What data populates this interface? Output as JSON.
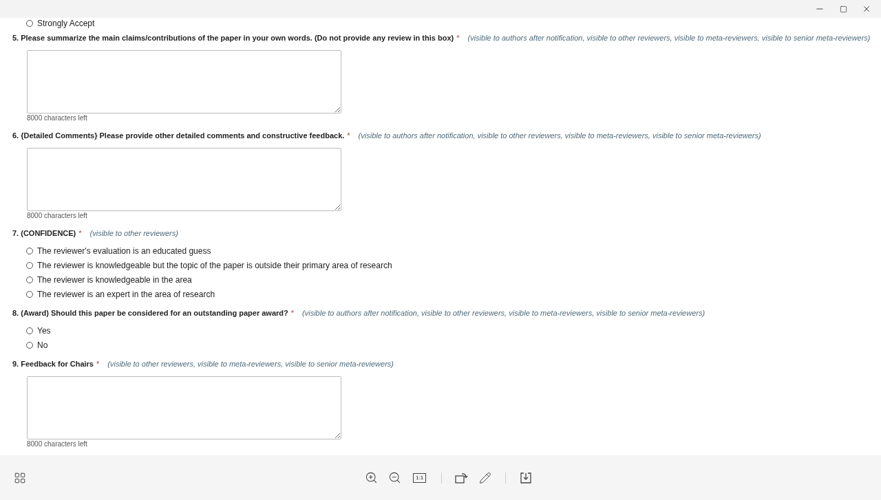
{
  "form": {
    "leading_options": [
      {
        "label": "Strongly Accept",
        "selected": false
      }
    ],
    "questions": [
      {
        "kind": "textarea",
        "label": "5. Please summarize the main claims/contributions of the paper in your own words. (Do not provide any review in this box)",
        "required_mark": "*",
        "visibility": "(visible to authors after notification, visible to other reviewers, visible to meta-reviewers, visible to senior meta-reviewers)",
        "counter": "8000 characters left"
      },
      {
        "kind": "textarea",
        "label": "6. {Detailed Comments} Please provide other detailed comments and constructive feedback.",
        "required_mark": "*",
        "visibility": "(visible to authors after notification, visible to other reviewers, visible to meta-reviewers, visible to senior meta-reviewers)",
        "counter": "8000 characters left"
      },
      {
        "kind": "radio",
        "label": "7. (CONFIDENCE)",
        "required_mark": "*",
        "visibility": "(visible to other reviewers)",
        "options": [
          {
            "label": "The reviewer's evaluation is an educated guess",
            "selected": false
          },
          {
            "label": "The reviewer is knowledgeable but the topic of the paper is outside their primary area of research",
            "selected": false
          },
          {
            "label": "The reviewer is knowledgeable in the area",
            "selected": false
          },
          {
            "label": "The reviewer is an expert in the area of research",
            "selected": false
          }
        ]
      },
      {
        "kind": "radio",
        "label": "8. (Award) Should this paper be considered for an outstanding paper award?",
        "required_mark": "*",
        "visibility": "(visible to authors after notification, visible to other reviewers, visible to meta-reviewers, visible to senior meta-reviewers)",
        "options": [
          {
            "label": "Yes",
            "selected": false
          },
          {
            "label": "No",
            "selected": false
          }
        ]
      },
      {
        "kind": "textarea",
        "label": "9. Feedback for Chairs",
        "required_mark": "*",
        "visibility": "(visible to other reviewers, visible to meta-reviewers, visible to senior meta-reviewers)",
        "counter": "8000 characters left"
      }
    ]
  },
  "toolbar": {
    "actual_size_label": "1:1"
  }
}
